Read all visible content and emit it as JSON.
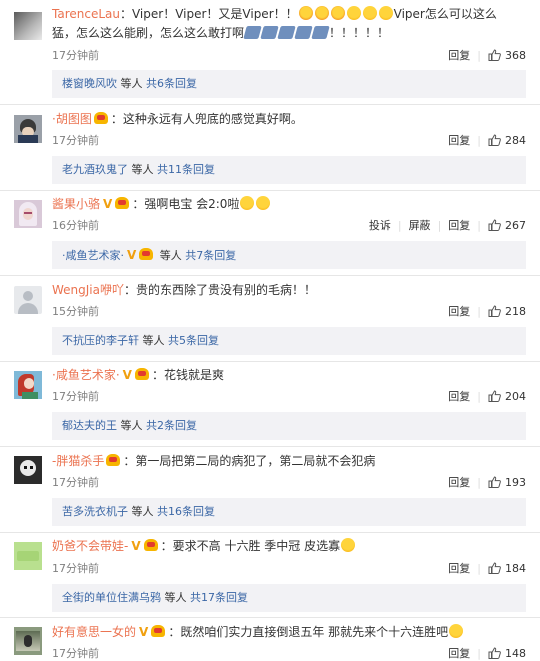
{
  "comments": [
    {
      "user": "TarenceLau",
      "text_a": "：Viper！Viper！又是Viper！！",
      "text_b": "Viper怎么可以这么猛，怎么这么能刷，怎么这么敢打啊",
      "text_c": "！！！！！",
      "time": "17分钟前",
      "reply": "回复",
      "likes": "368",
      "sub_user": "楼窗晚风吹",
      "sub_etc": " 等人 ",
      "sub_count": "共6条回复"
    },
    {
      "user": "·胡图图",
      "text": "：这种永远有人兜底的感觉真好啊。",
      "time": "17分钟前",
      "reply": "回复",
      "likes": "284",
      "sub_user": "老九酒玖鬼了",
      "sub_etc": " 等人 ",
      "sub_count": "共11条回复"
    },
    {
      "user": "酱果小骆",
      "text": "：强啊电宝 会2:0啦",
      "time": "16分钟前",
      "report": "投诉",
      "block": "屏蔽",
      "reply": "回复",
      "likes": "267",
      "sub_user": "·咸鱼艺术家·",
      "sub_etc": " 等人 ",
      "sub_count": "共7条回复"
    },
    {
      "user": "WengJia咿吖",
      "text": "：贵的东西除了贵没有别的毛病！！",
      "time": "15分钟前",
      "reply": "回复",
      "likes": "218",
      "sub_user": "不抗压的李子轩",
      "sub_etc": " 等人 ",
      "sub_count": "共5条回复"
    },
    {
      "user": "·咸鱼艺术家·",
      "text": "：花钱就是爽",
      "time": "17分钟前",
      "reply": "回复",
      "likes": "204",
      "sub_user": "郁达夫的王",
      "sub_etc": " 等人 ",
      "sub_count": "共2条回复"
    },
    {
      "user": "-胖猫杀手",
      "text": "：第一局把第二局的病犯了，第二局就不会犯病",
      "time": "17分钟前",
      "reply": "回复",
      "likes": "193",
      "sub_user": "苦多洗衣机子",
      "sub_etc": " 等人 ",
      "sub_count": "共16条回复"
    },
    {
      "user": "奶爸不会带娃-",
      "text": "：要求不高 十六胜 季中冠 皮选寡",
      "time": "17分钟前",
      "reply": "回复",
      "likes": "184",
      "sub_user": "全街的单位住满乌鸦",
      "sub_etc": " 等人 ",
      "sub_count": "共17条回复"
    },
    {
      "user": "好有意思一女的",
      "text": "：既然咱们实力直接倒退五年 那就先来个十六连胜吧",
      "time": "17分钟前",
      "reply": "回复",
      "likes": "148"
    }
  ],
  "icons": {
    "like": "thumbs-up-icon",
    "vip": "vip-v-icon",
    "crown": "crown-badge-icon",
    "emoji": "emoji-icon"
  },
  "colors": {
    "username": "#eb7350",
    "link": "#3b67a6",
    "meta": "#808080",
    "reply_bg": "#f2f2f5",
    "vip": "#f0a010"
  }
}
